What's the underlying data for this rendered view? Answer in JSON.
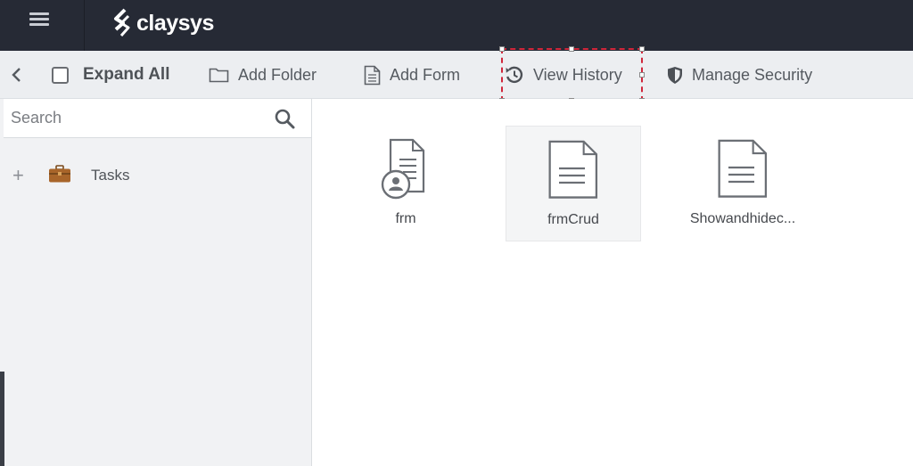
{
  "app": {
    "brand": "claysys"
  },
  "toolbar": {
    "back_icon": "chevron-left-icon",
    "expand_all_label": "Expand All",
    "add_folder_label": "Add Folder",
    "add_form_label": "Add Form",
    "view_history_label": "View History",
    "manage_security_label": "Manage Security"
  },
  "sidebar": {
    "search_placeholder": "Search",
    "tree": [
      {
        "label": "Tasks",
        "expander": "+"
      }
    ]
  },
  "forms": [
    {
      "name": "frm",
      "icon": "user-form-icon"
    },
    {
      "name": "frmCrud",
      "icon": "document-icon",
      "selected": true
    },
    {
      "name": "Showandhidec...",
      "icon": "document-icon"
    }
  ],
  "colors": {
    "topbar": "#262a35",
    "highlight": "#d0263a",
    "briefcase": "#a8652a"
  }
}
